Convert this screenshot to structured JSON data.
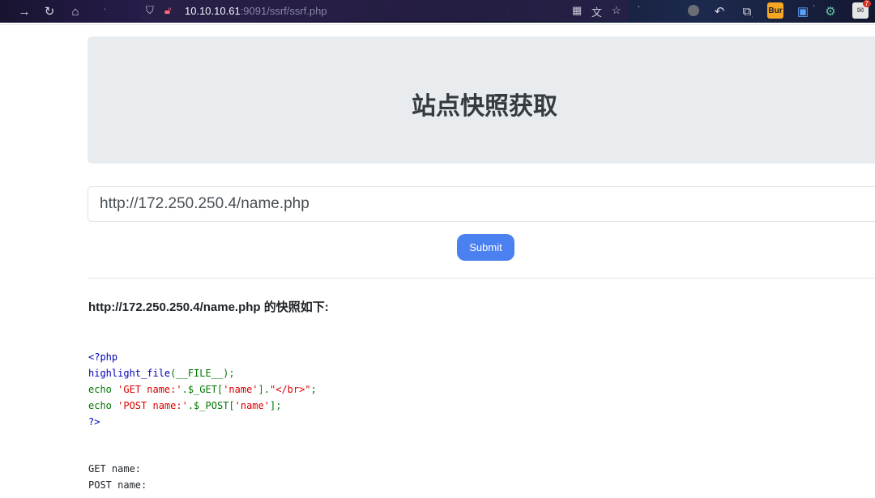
{
  "browser": {
    "url_host": "10.10.10.61",
    "url_port_path": ":9091/ssrf/ssrf.php",
    "extensions": {
      "burp_label": "Bur",
      "badge_count": "7"
    }
  },
  "page": {
    "title": "站点快照获取",
    "input_value": "http://172.250.250.4/name.php",
    "submit_label": "Submit",
    "result_title": "http://172.250.250.4/name.php 的快照如下:",
    "code": {
      "line1": "<?php",
      "line2_fn": "highlight_file",
      "line2_rest": "(__FILE__);",
      "line3_echo": "echo ",
      "line3_str1": "'GET name:'",
      "line3_mid": ".$_GET[",
      "line3_key": "'name'",
      "line3_close": "].",
      "line3_str2": "\"</br>\"",
      "line3_end": ";",
      "line4_echo": "echo ",
      "line4_str1": "'POST name:'",
      "line4_mid": ".$_POST[",
      "line4_key": "'name'",
      "line4_end": "];",
      "line5": "?>"
    },
    "output": {
      "line1": "GET name:",
      "line2": "POST name:"
    }
  }
}
